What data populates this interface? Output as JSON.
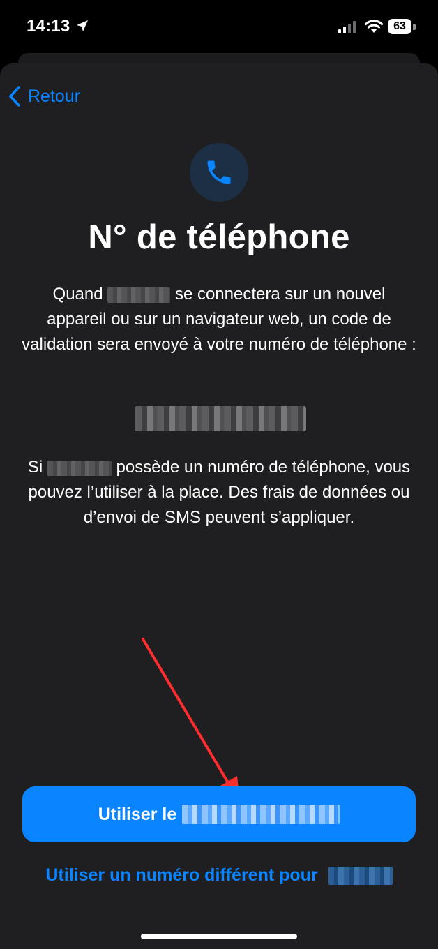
{
  "status_bar": {
    "time": "14:13",
    "battery": "63"
  },
  "nav": {
    "back_label": "Retour"
  },
  "header": {
    "title": "N° de téléphone"
  },
  "body": {
    "para1_start": "Quand",
    "para1_end": "se connectera sur un nouvel appareil ou sur un navigateur web, un code de validation sera envoyé à votre numéro de téléphone :",
    "para2_start": "Si",
    "para2_end": "possède un numéro de téléphone, vous pouvez l’utiliser à la place. Des frais de données ou d’envoi de SMS peuvent s’appliquer."
  },
  "actions": {
    "primary_label": "Utiliser le",
    "secondary_label": "Utiliser un numéro différent pour"
  },
  "colors": {
    "accent": "#0a84ff",
    "sheet_bg": "#1f1f21",
    "annotation_arrow": "#ff2d2d"
  },
  "icons": {
    "location": "location-arrow-icon",
    "phone": "phone-icon",
    "back": "chevron-left-icon"
  }
}
